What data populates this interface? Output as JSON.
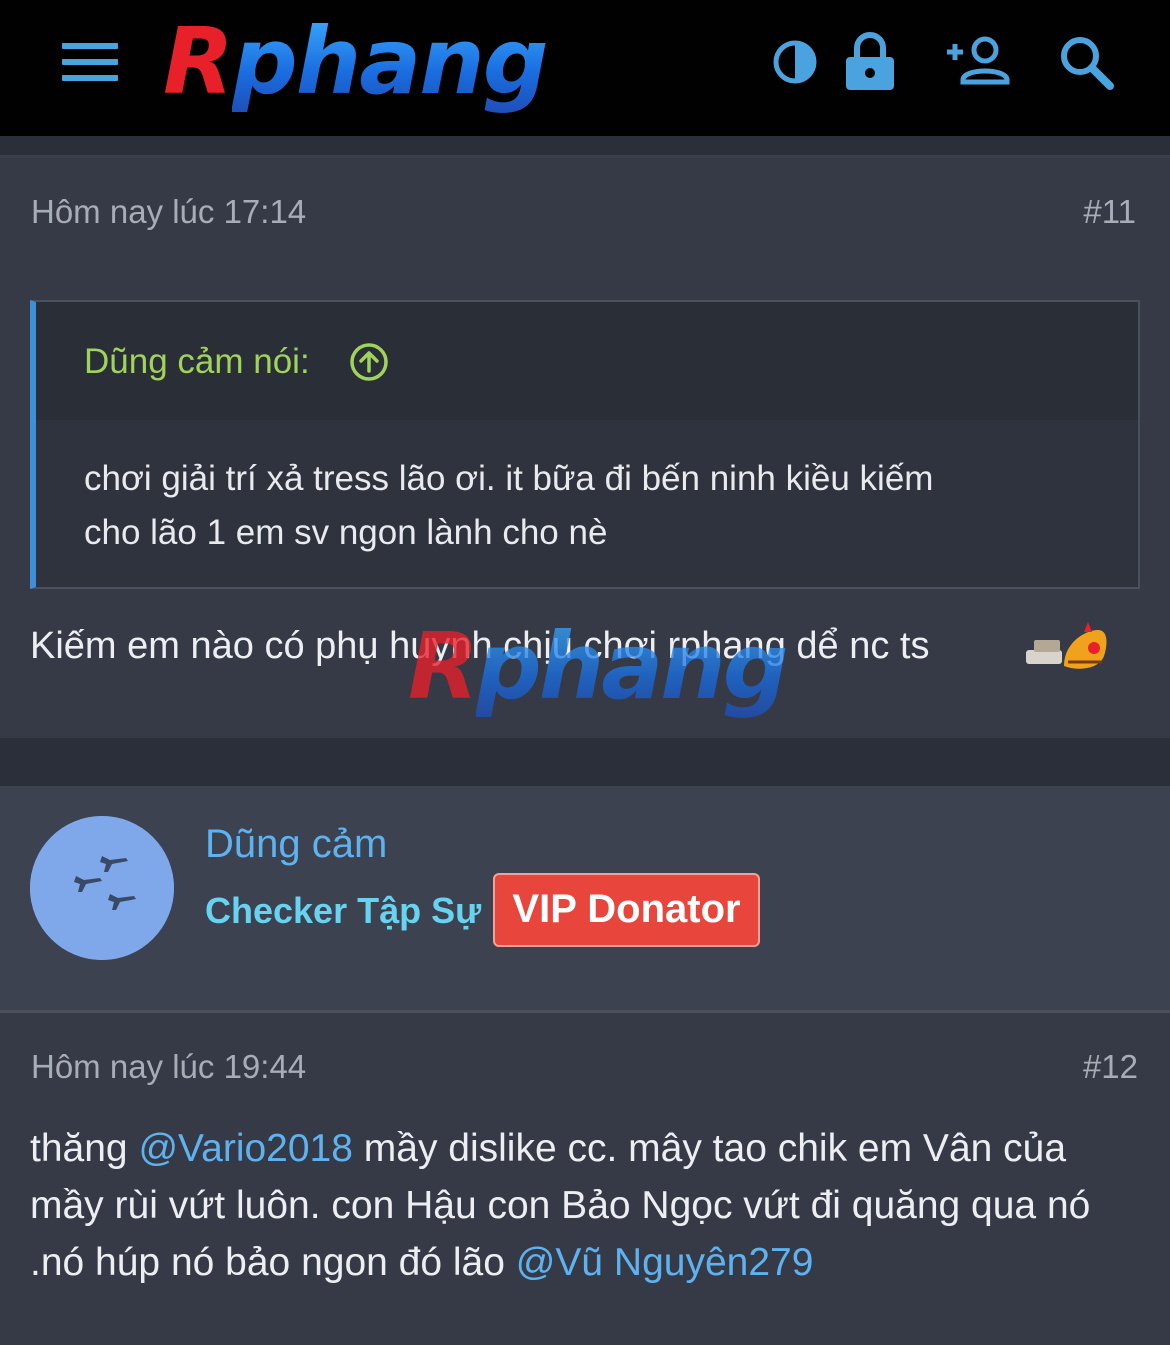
{
  "header": {
    "logo_r": "R",
    "logo_rest": "phang",
    "icons": [
      "menu-icon",
      "contrast-icon",
      "lock-icon",
      "add-user-icon",
      "search-icon"
    ]
  },
  "posts": [
    {
      "date": "Hôm nay lúc 17:14",
      "number": "#11",
      "quote": {
        "author": "Dũng cảm nói:",
        "lines": [
          "chơi giải trí xả tress lão ơi. it bữa đi bến ninh kiều kiếm",
          "cho lão 1 em sv ngon lành cho nè"
        ]
      },
      "text": "Kiếm em nào có phụ huynh chịu chơi rphang dể nc ts",
      "watermark_r": "R",
      "watermark_rest": "phang"
    },
    {
      "date": "Hôm nay lúc 19:44",
      "number": "#12",
      "body": {
        "p1": "thăng ",
        "mention1": "@Vario2018",
        "p2": " mầy dislike cc. mây tao chik em Vân của mầy rùi vứt luôn. con Hậu con Bảo Ngọc vứt đi quăng qua nó .nó húp nó bảo ngon đó lão ",
        "mention2": "@Vũ Nguyên279"
      }
    }
  ],
  "user": {
    "name": "Dũng cảm",
    "title": "Checker Tập Sự",
    "badge": "VIP Donator"
  },
  "colors": {
    "accent_blue": "#5eb2f0",
    "quote_green": "#9fd35a",
    "badge_red": "#e8453c",
    "title_cyan": "#67d3f0"
  }
}
